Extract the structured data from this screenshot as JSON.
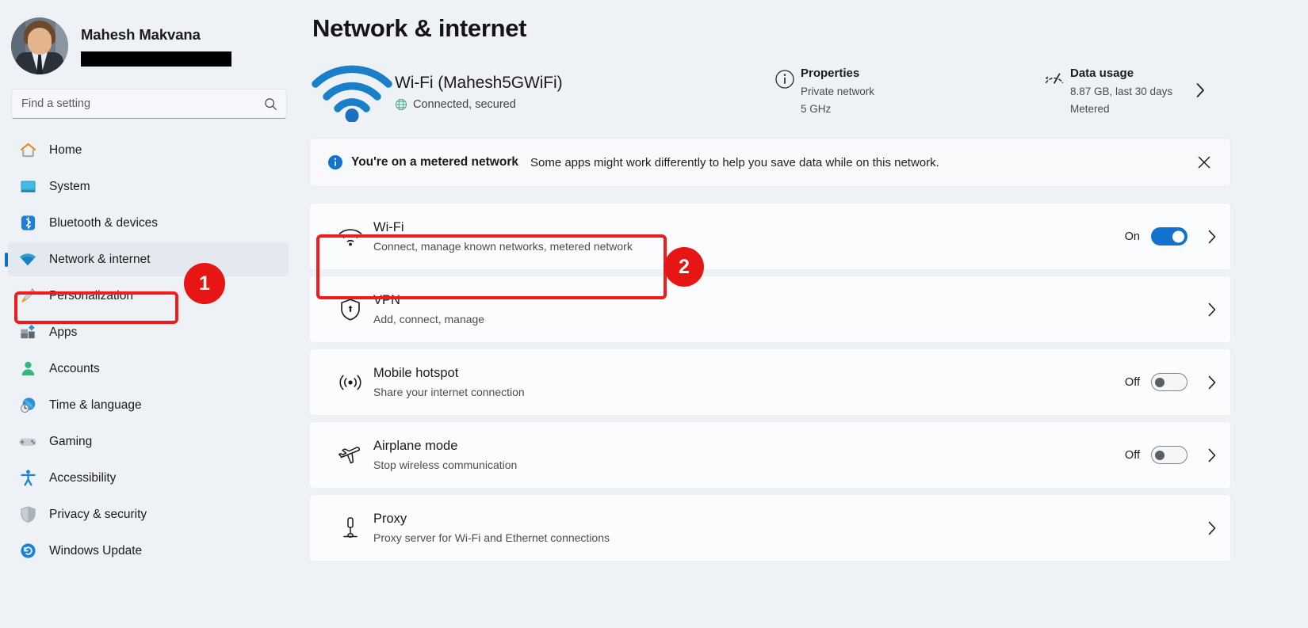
{
  "account": {
    "name": "Mahesh Makvana",
    "email_redacted": true
  },
  "search": {
    "placeholder": "Find a setting",
    "value": "",
    "icon": "search-icon"
  },
  "sidebar": {
    "items": [
      {
        "label": "Home",
        "icon": "home-icon",
        "selected": false
      },
      {
        "label": "System",
        "icon": "system-icon",
        "selected": false
      },
      {
        "label": "Bluetooth & devices",
        "icon": "bluetooth-icon",
        "selected": false
      },
      {
        "label": "Network & internet",
        "icon": "wifi-icon",
        "selected": true
      },
      {
        "label": "Personalization",
        "icon": "brush-icon",
        "selected": false
      },
      {
        "label": "Apps",
        "icon": "apps-icon",
        "selected": false
      },
      {
        "label": "Accounts",
        "icon": "accounts-icon",
        "selected": false
      },
      {
        "label": "Time & language",
        "icon": "clock-globe-icon",
        "selected": false
      },
      {
        "label": "Gaming",
        "icon": "gamepad-icon",
        "selected": false
      },
      {
        "label": "Accessibility",
        "icon": "accessibility-icon",
        "selected": false
      },
      {
        "label": "Privacy & security",
        "icon": "shield-icon",
        "selected": false
      },
      {
        "label": "Windows Update",
        "icon": "update-icon",
        "selected": false
      }
    ]
  },
  "page": {
    "title": "Network & internet"
  },
  "status": {
    "connection_icon": "wifi-signal-icon",
    "connection_name": "Wi-Fi (Mahesh5GWiFi)",
    "connection_state_icon": "globe-icon",
    "connection_state": "Connected, secured",
    "properties": {
      "icon": "info-icon",
      "title": "Properties",
      "lines": [
        "Private network",
        "5 GHz"
      ]
    },
    "data_usage": {
      "icon": "gauge-icon",
      "title": "Data usage",
      "lines": [
        "8.87 GB, last 30 days",
        "Metered"
      ],
      "chevron": "chevron-right-icon"
    }
  },
  "banner": {
    "icon": "info-filled-icon",
    "strong": "You're on a metered network",
    "text": "Some apps might work differently to help you save data while on this network.",
    "close_icon": "close-icon"
  },
  "settings_rows": [
    {
      "icon": "wifi-icon",
      "title": "Wi-Fi",
      "subtitle": "Connect, manage known networks, metered network",
      "toggle": {
        "present": true,
        "state": "On",
        "on": true
      },
      "chevron": "chevron-right-icon"
    },
    {
      "icon": "vpn-shield-icon",
      "title": "VPN",
      "subtitle": "Add, connect, manage",
      "toggle": {
        "present": false,
        "state": "",
        "on": false
      },
      "chevron": "chevron-right-icon"
    },
    {
      "icon": "hotspot-icon",
      "title": "Mobile hotspot",
      "subtitle": "Share your internet connection",
      "toggle": {
        "present": true,
        "state": "Off",
        "on": false
      },
      "chevron": "chevron-right-icon"
    },
    {
      "icon": "airplane-icon",
      "title": "Airplane mode",
      "subtitle": "Stop wireless communication",
      "toggle": {
        "present": true,
        "state": "Off",
        "on": false
      },
      "chevron": "chevron-right-icon"
    },
    {
      "icon": "proxy-icon",
      "title": "Proxy",
      "subtitle": "Proxy server for Wi-Fi and Ethernet connections",
      "toggle": {
        "present": false,
        "state": "",
        "on": false
      },
      "chevron": "chevron-right-icon"
    }
  ],
  "annotations": {
    "accent_color": "#e81515",
    "highlight_color": "#f01b1b",
    "steps": [
      {
        "number": "1",
        "target": "sidebar-item-network-internet"
      },
      {
        "number": "2",
        "target": "settings-row-wi-fi"
      }
    ]
  },
  "colors": {
    "accent_blue": "#1272cd",
    "sidebar_bg": "#eef2f7",
    "row_bg": "#fbfcfd"
  }
}
